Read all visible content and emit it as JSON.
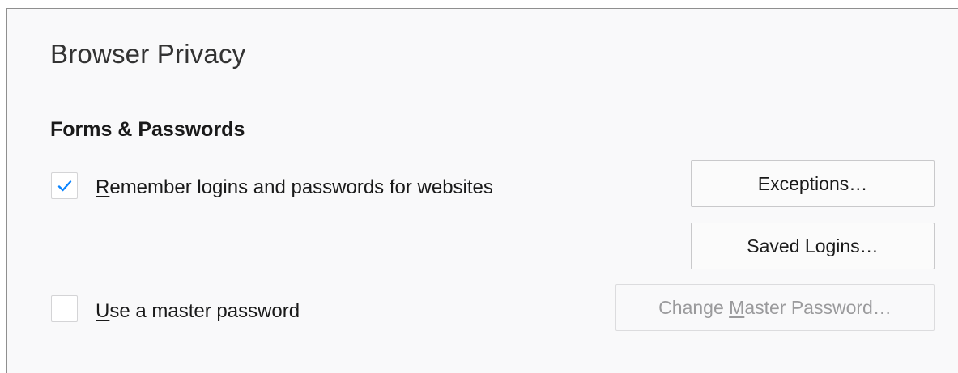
{
  "page": {
    "title": "Browser Privacy"
  },
  "section": {
    "title": "Forms & Passwords"
  },
  "options": {
    "remember_logins": {
      "label_prefix": "",
      "label_key": "R",
      "label_rest": "emember logins and passwords for websites",
      "checked": true
    },
    "master_password": {
      "label_prefix": "",
      "label_key": "U",
      "label_rest": "se a master password",
      "checked": false
    }
  },
  "buttons": {
    "exceptions": {
      "label": "Exceptions…"
    },
    "saved_logins": {
      "label": "Saved Logins…"
    },
    "change_master": {
      "label_prefix": "Change ",
      "label_key": "M",
      "label_rest": "aster Password…",
      "enabled": false
    }
  },
  "colors": {
    "check_accent": "#0a84ff",
    "panel_bg": "#f9f9fa"
  }
}
